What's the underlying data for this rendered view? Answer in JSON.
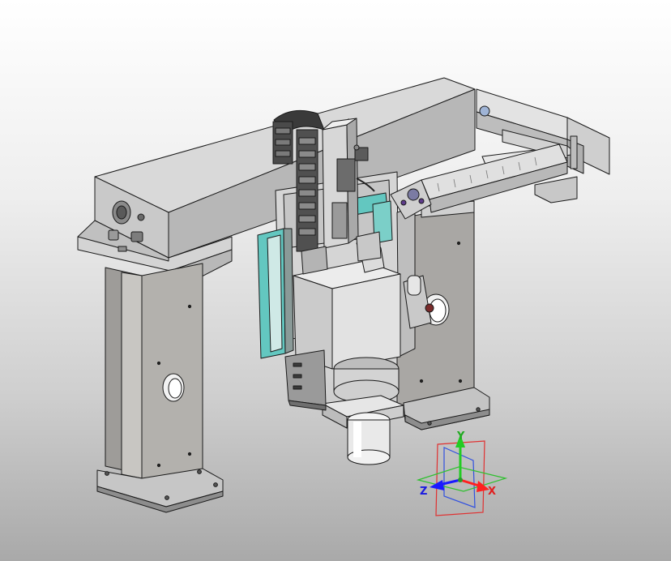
{
  "viewport": {
    "background_top": "#ffffff",
    "background_bottom": "#a9a9a9"
  },
  "model": {
    "body_color": "#d6d6d6",
    "shade_color": "#a9a7a4",
    "accent_color": "#63c7c0",
    "edge_color": "#1a1a1a"
  },
  "triad": {
    "x_label": "X",
    "y_label": "Y",
    "z_label": "Z",
    "x_color": "#ff2020",
    "y_color": "#22cc22",
    "z_color": "#1a1aff"
  }
}
